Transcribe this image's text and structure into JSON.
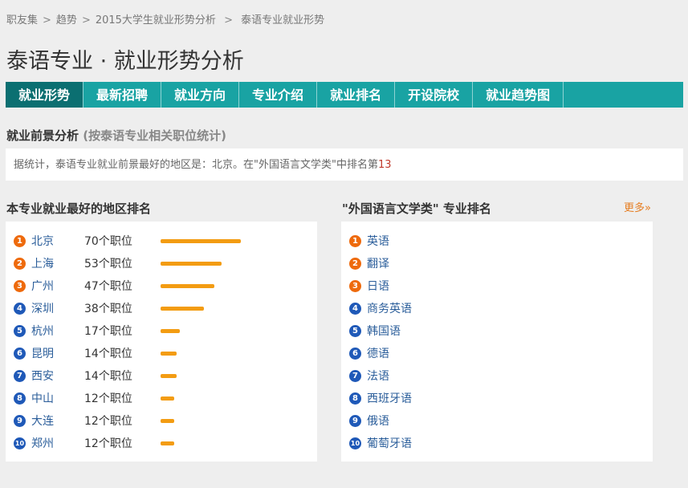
{
  "breadcrumb": [
    "职友集",
    "趋势",
    "2015大学生就业形势分析",
    "泰语专业就业形势"
  ],
  "page_title": "泰语专业 · 就业形势分析",
  "tabs": [
    "就业形势",
    "最新招聘",
    "就业方向",
    "专业介绍",
    "就业排名",
    "开设院校",
    "就业趋势图"
  ],
  "active_tab": 0,
  "prospect": {
    "title": "就业前景分析",
    "subtitle": "(按泰语专业相关职位统计)",
    "text": "据统计，泰语专业就业前景最好的地区是：北京。在\"外国语言文学类\"中排名第",
    "rank": "13"
  },
  "regions": {
    "title": "本专业就业最好的地区排名",
    "max_jobs": 70,
    "items": [
      {
        "rank": "1",
        "name": "北京",
        "count": "70个职位",
        "jobs": 70
      },
      {
        "rank": "2",
        "name": "上海",
        "count": "53个职位",
        "jobs": 53
      },
      {
        "rank": "3",
        "name": "广州",
        "count": "47个职位",
        "jobs": 47
      },
      {
        "rank": "4",
        "name": "深圳",
        "count": "38个职位",
        "jobs": 38
      },
      {
        "rank": "5",
        "name": "杭州",
        "count": "17个职位",
        "jobs": 17
      },
      {
        "rank": "6",
        "name": "昆明",
        "count": "14个职位",
        "jobs": 14
      },
      {
        "rank": "7",
        "name": "西安",
        "count": "14个职位",
        "jobs": 14
      },
      {
        "rank": "8",
        "name": "中山",
        "count": "12个职位",
        "jobs": 12
      },
      {
        "rank": "9",
        "name": "大连",
        "count": "12个职位",
        "jobs": 12
      },
      {
        "rank": "10",
        "name": "郑州",
        "count": "12个职位",
        "jobs": 12
      }
    ]
  },
  "majors": {
    "title": "\"外国语言文学类\" 专业排名",
    "more": "更多»",
    "items": [
      {
        "rank": "1",
        "name": "英语"
      },
      {
        "rank": "2",
        "name": "翻译"
      },
      {
        "rank": "3",
        "name": "日语"
      },
      {
        "rank": "4",
        "name": "商务英语"
      },
      {
        "rank": "5",
        "name": "韩国语"
      },
      {
        "rank": "6",
        "name": "德语"
      },
      {
        "rank": "7",
        "name": "法语"
      },
      {
        "rank": "8",
        "name": "西班牙语"
      },
      {
        "rank": "9",
        "name": "俄语"
      },
      {
        "rank": "10",
        "name": "葡萄牙语"
      }
    ]
  },
  "colors": {
    "tab_bar": "#19a3a3",
    "tab_active": "#0b6f71",
    "bar": "#f39c12",
    "badge_top": "#ee6a0c",
    "badge_rest": "#1f59b8",
    "link": "#2a5d9a",
    "more": "#e67e22"
  }
}
